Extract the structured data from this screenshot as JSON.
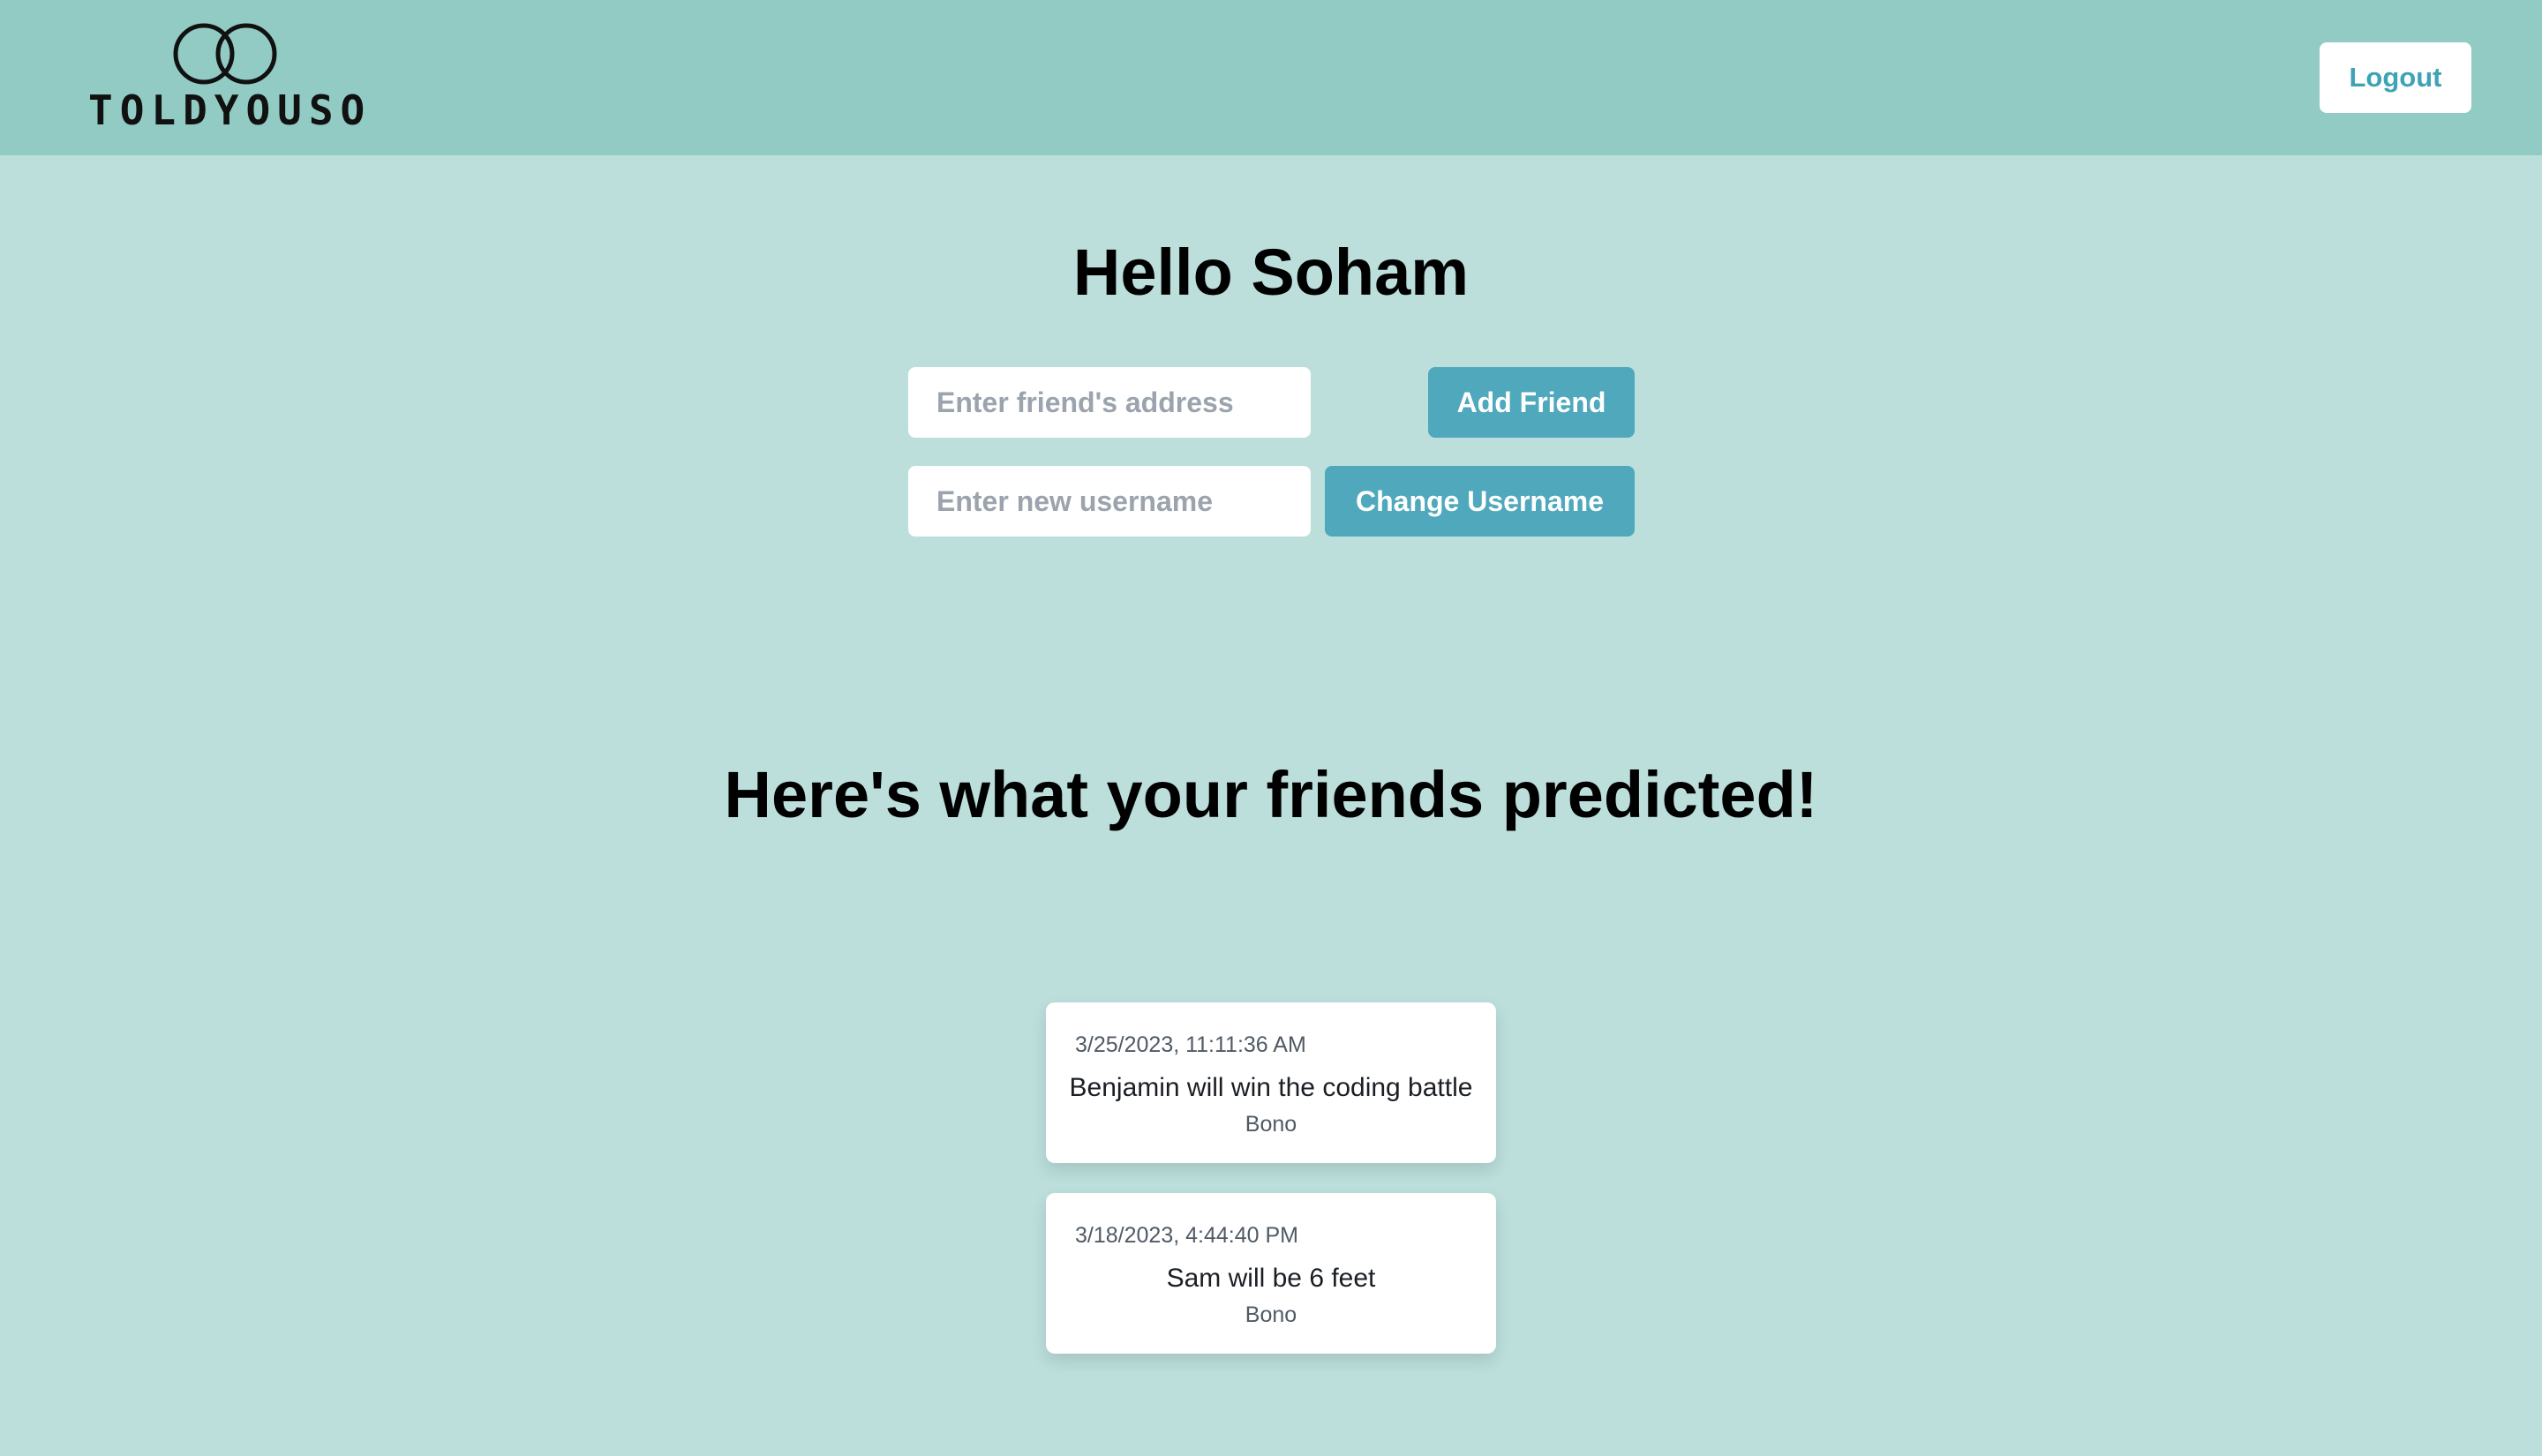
{
  "header": {
    "logo_text": "TOLDYOUSO",
    "logout_label": "Logout"
  },
  "greeting": "Hello Soham",
  "add_friend": {
    "placeholder": "Enter friend's address",
    "button_label": "Add Friend"
  },
  "change_username": {
    "placeholder": "Enter new username",
    "button_label": "Change Username"
  },
  "predictions_title": "Here's what your friends predicted!",
  "predictions": [
    {
      "timestamp": "3/25/2023, 11:11:36 AM",
      "text": "Benjamin will win the coding battle",
      "author": "Bono"
    },
    {
      "timestamp": "3/18/2023, 4:44:40 PM",
      "text": "Sam will be 6 feet",
      "author": "Bono"
    }
  ],
  "colors": {
    "header_bg": "#92cbc4",
    "page_bg": "#bcdfdc",
    "accent": "#4fa8bc",
    "logout_text": "#3ea3b4"
  },
  "icons": {
    "logo": "interlocking-rings-icon"
  }
}
